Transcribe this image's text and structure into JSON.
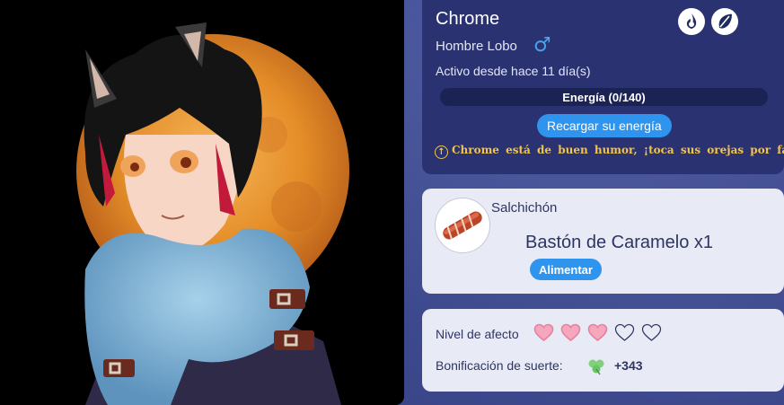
{
  "character": {
    "name": "Chrome",
    "species": "Hombre Lobo",
    "gender_symbol": "♂",
    "active_since": "Activo desde hace 11 día(s)",
    "energy_label": "Energía (0/140)",
    "energy_value": 0,
    "energy_max": 140,
    "recharge_label": "Recargar su energía",
    "mood_message": "Chrome está de buen humor, ¡toca sus orejas por favor!"
  },
  "header_icons": [
    "blue-flame-icon",
    "green-leaf-icon"
  ],
  "food": {
    "category": "Salchichón",
    "item": "Bastón de Caramelo x1",
    "feed_label": "Alimentar",
    "icon": "sausage-icon"
  },
  "stats": {
    "affection_label": "Nivel de afecto",
    "affection_filled": 3,
    "affection_total": 5,
    "luck_label": "Bonificación de suerte:",
    "luck_value": "+343",
    "luck_icon": "clover-icon"
  },
  "colors": {
    "accent": "#2e94ee",
    "mood_text": "#f2c447",
    "heart_filled": "#f4a7bd"
  }
}
